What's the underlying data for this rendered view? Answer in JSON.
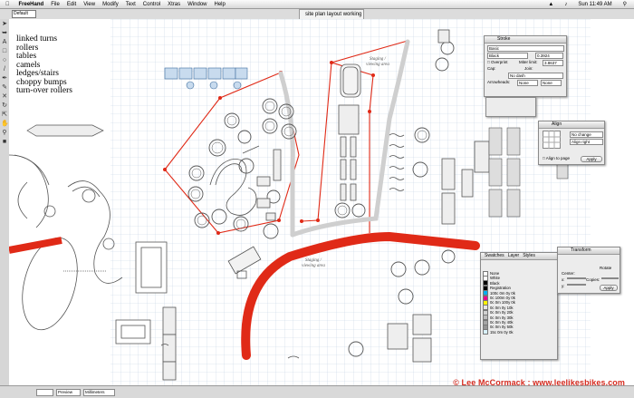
{
  "menubar": {
    "app_name": "FreeHand",
    "items": [
      "File",
      "Edit",
      "View",
      "Modify",
      "Text",
      "Control",
      "Xtras",
      "Window",
      "Help"
    ],
    "clock": "Sun 11:49 AM"
  },
  "toolbar": {
    "zoom": "Default"
  },
  "document": {
    "tab_title": "site plan layout working 5"
  },
  "notes": [
    "linked turns",
    "rollers",
    "tables",
    "camels",
    "ledges/stairs",
    "choppy bumps",
    "turn-over rollers"
  ],
  "labels": {
    "staging_top": "Staging / viewing area",
    "staging_bottom": "Staging / viewing area"
  },
  "stroke_panel": {
    "tab": "Stroke",
    "style": "Basic",
    "color": "Black",
    "width": "0.3924",
    "overprint": "Overprint",
    "miter_label": "Miter limit:",
    "miter": "3.8637",
    "cap_label": "Cap:",
    "join_label": "Join:",
    "dash": "No dash",
    "arrowheads_label": "Arrowheads:",
    "arrow_start": "None",
    "arrow_end": "None"
  },
  "align_panel": {
    "title": "Align",
    "horizontal": "No change",
    "vertical": "Align right",
    "align_to_page": "Align to page",
    "apply": "Apply"
  },
  "swatches_panel": {
    "tabs": [
      "Swatches",
      "Layer",
      "Styles"
    ],
    "items": [
      {
        "name": "None",
        "color": "#ffffff"
      },
      {
        "name": "White",
        "color": "#ffffff"
      },
      {
        "name": "Black",
        "color": "#000000"
      },
      {
        "name": "Registration",
        "color": "#000000"
      },
      {
        "name": "100c 0m 0y 0k",
        "color": "#00aeef"
      },
      {
        "name": "0c 100m 0y 0k",
        "color": "#ec008c"
      },
      {
        "name": "0c 0m 100y 0k",
        "color": "#fff200"
      },
      {
        "name": "0c 0m 0y 10k",
        "color": "#e6e6e6"
      },
      {
        "name": "0c 0m 0y 20k",
        "color": "#d1d1d1"
      },
      {
        "name": "0c 0m 0y 30k",
        "color": "#bcbcbc"
      },
      {
        "name": "0c 0m 0y 40k",
        "color": "#a6a6a6"
      },
      {
        "name": "0c 0m 0y 50k",
        "color": "#939393"
      },
      {
        "name": "15c 0m 0y 0k",
        "color": "#d9f1fb"
      }
    ]
  },
  "transform_panel": {
    "title": "Transform",
    "rotate": "Rotate",
    "center": "Center:",
    "copies": "Copies:",
    "x": "x:",
    "y": "y:",
    "apply": "Apply"
  },
  "bottom_bar": {
    "preview": "Preview",
    "units": "Millimeters"
  },
  "credit": "© Lee McCormack : www.leelikesbikes.com",
  "colors": {
    "red_path": "#e02a17",
    "grid": "#c4d4e4",
    "gray_path": "#cfcfcf"
  }
}
